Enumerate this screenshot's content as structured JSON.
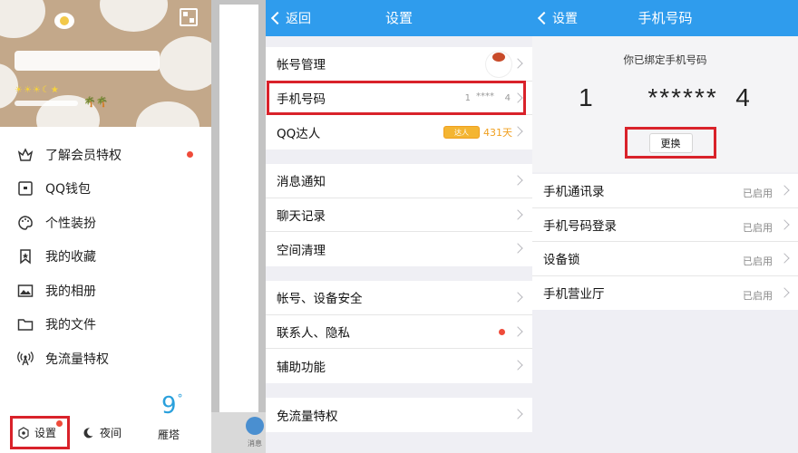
{
  "drawer": {
    "menu": [
      {
        "label": "了解会员特权",
        "icon": "crown-icon",
        "badge": true
      },
      {
        "label": "QQ钱包",
        "icon": "wallet-icon",
        "badge": false
      },
      {
        "label": "个性装扮",
        "icon": "palette-icon",
        "badge": false
      },
      {
        "label": "我的收藏",
        "icon": "bookmark-icon",
        "badge": false
      },
      {
        "label": "我的相册",
        "icon": "photo-icon",
        "badge": false
      },
      {
        "label": "我的文件",
        "icon": "folder-icon",
        "badge": false
      },
      {
        "label": "免流量特权",
        "icon": "signal-icon",
        "badge": false
      }
    ],
    "bottom": {
      "settings_label": "设置",
      "night_label": "夜间",
      "weather_temp": "9",
      "weather_degree": "°",
      "weather_city": "雁塔"
    }
  },
  "behind": {
    "tab_label": "消息"
  },
  "settings": {
    "nav": {
      "back_label": "返回",
      "title": "设置"
    },
    "groups": [
      [
        {
          "label": "帐号管理"
        },
        {
          "label": "手机号码",
          "value_prefix": "1",
          "value_mask": "****",
          "value_suffix": "4"
        },
        {
          "label": "QQ达人",
          "talent_badge": "达人",
          "talent_days": "431天"
        }
      ],
      [
        {
          "label": "消息通知"
        },
        {
          "label": "聊天记录"
        },
        {
          "label": "空间清理"
        }
      ],
      [
        {
          "label": "帐号、设备安全"
        },
        {
          "label": "联系人、隐私",
          "badge": true
        },
        {
          "label": "辅助功能"
        }
      ],
      [
        {
          "label": "免流量特权"
        }
      ]
    ]
  },
  "phone": {
    "nav": {
      "back_label": "设置",
      "title": "手机号码"
    },
    "bound_label": "你已绑定手机号码",
    "number": "1      ******  4",
    "change_label": "更换",
    "rows": [
      {
        "label": "手机通讯录",
        "status": "已启用"
      },
      {
        "label": "手机号码登录",
        "status": "已启用"
      },
      {
        "label": "设备锁",
        "status": "已启用"
      },
      {
        "label": "手机营业厅",
        "status": "已启用"
      }
    ]
  },
  "colors": {
    "nav_blue": "#2f9ced",
    "highlight_red": "#d9222a",
    "badge_red": "#ef4b3a",
    "weather_blue": "#2aa0dc"
  }
}
